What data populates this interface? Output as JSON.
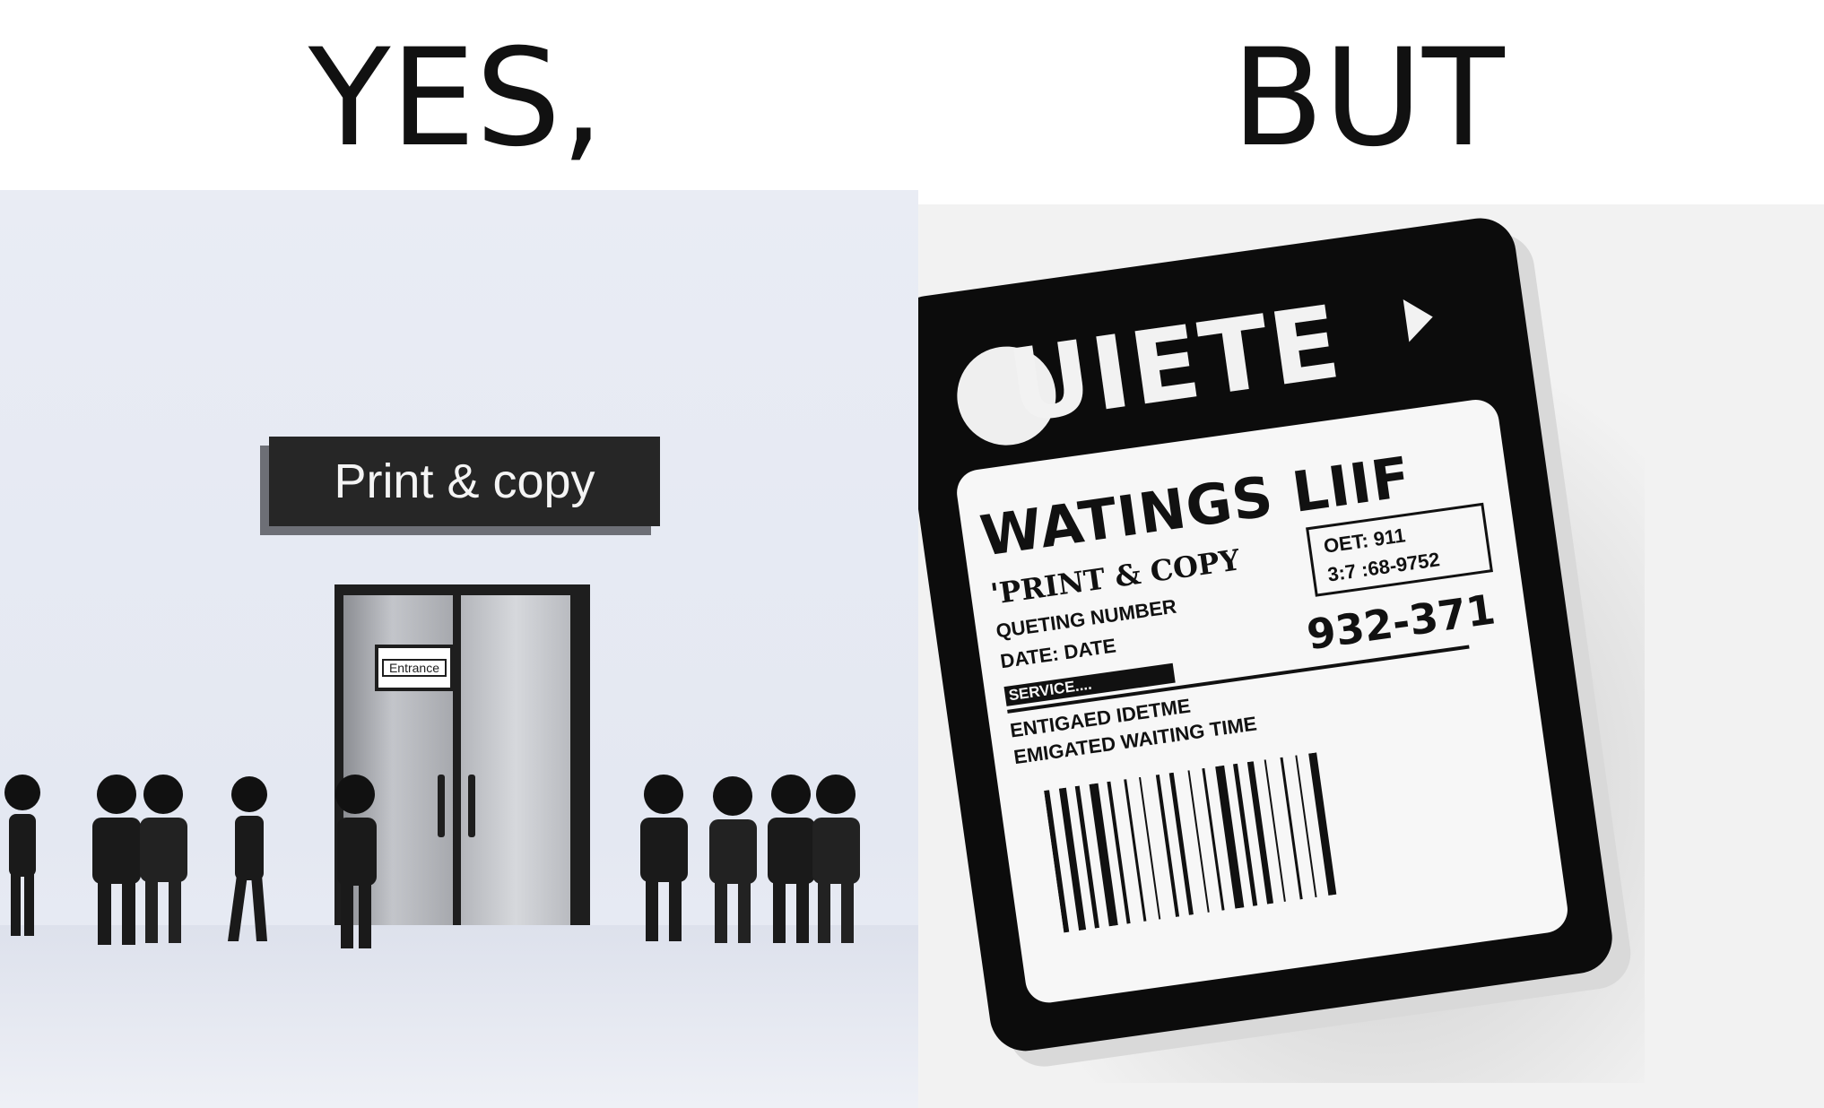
{
  "headings": {
    "left": "YES,",
    "right": "BUT"
  },
  "left_scene": {
    "store_sign": "Print & copy",
    "door_sign": "Entrance"
  },
  "ticket": {
    "brand": "UIETE",
    "title": "WATINGS LIIF",
    "service": "'PRINT & COPY",
    "queueing_label": "QUETING NUMBER",
    "date_label": "DATE:    DATE",
    "service_label": "SERVICE....",
    "est_line_1": "ENTIGAED IDETME",
    "est_line_2": "EMIGATED WAITING TIME",
    "info_line_1": "OET: 911",
    "info_line_2": "3:7 :68-9752",
    "queue_number": "932-371"
  },
  "colors": {
    "ink": "#111111",
    "panel_left_bg": "#e9ecf4",
    "ticket_body": "#0c0c0c",
    "label_bg": "#f7f7f7"
  }
}
